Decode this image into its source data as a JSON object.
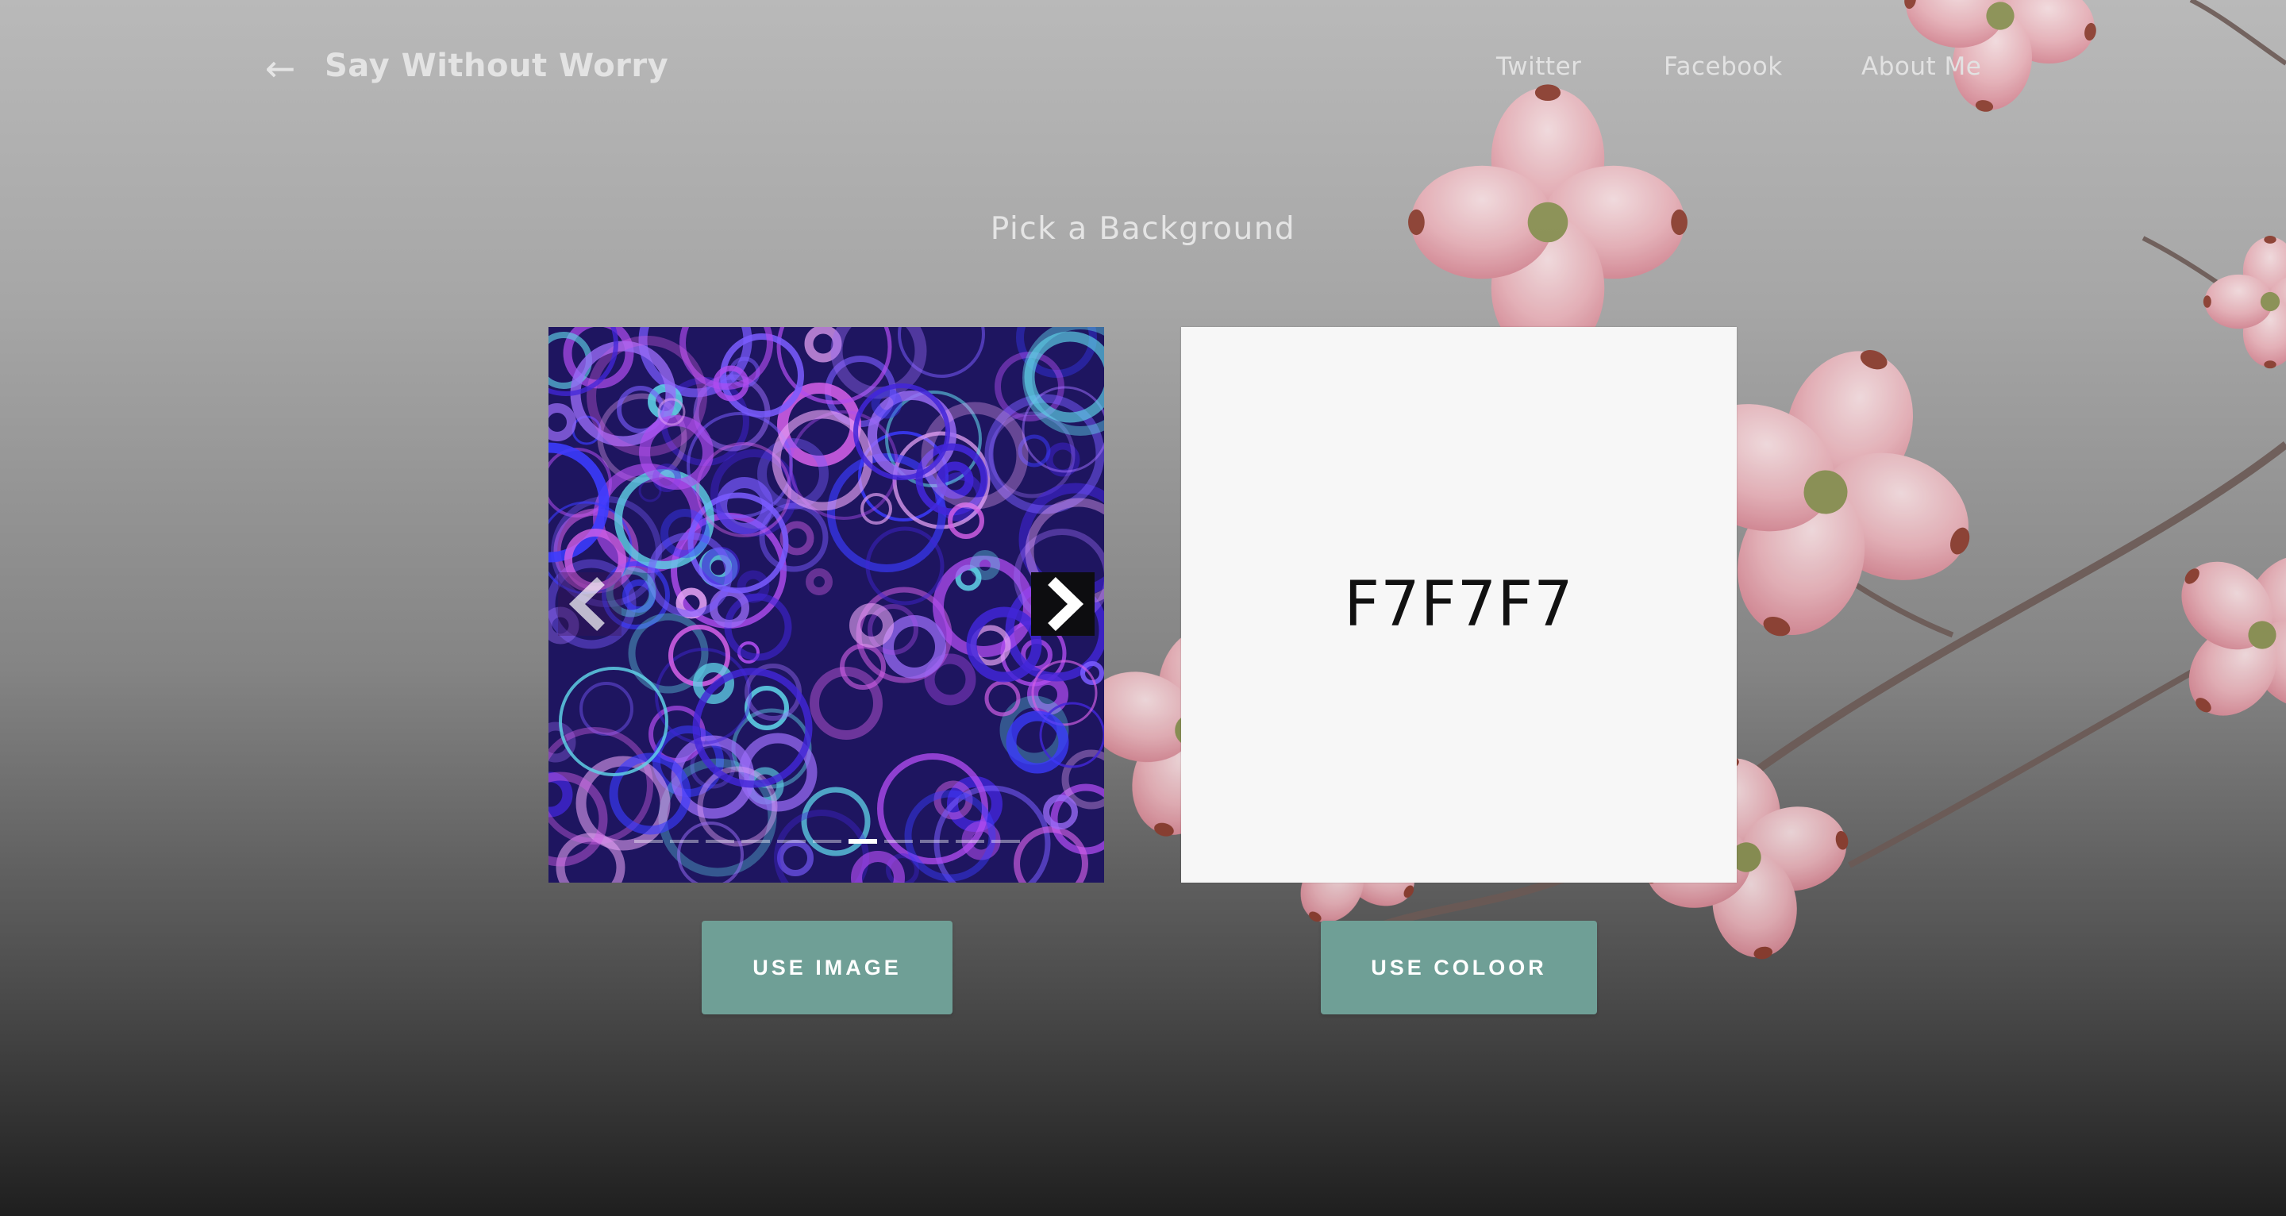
{
  "header": {
    "back_icon": "arrow-left-icon",
    "brand": "Say Without Worry",
    "links": [
      "Twitter",
      "Facebook",
      "About Me"
    ]
  },
  "main": {
    "heading": "Pick a Background",
    "carousel": {
      "prev_icon": "chevron-left-icon",
      "next_icon": "chevron-right-icon",
      "slide_count": 11,
      "active_slide": 7
    },
    "swatch": {
      "code": "F7F7F7",
      "color": "#F7F7F7"
    },
    "buttons": {
      "use_image": "USE IMAGE",
      "use_colour": "USE COLOOR"
    }
  },
  "colors": {
    "button": "#6F9F96",
    "text_light": "#E4E4E4"
  }
}
